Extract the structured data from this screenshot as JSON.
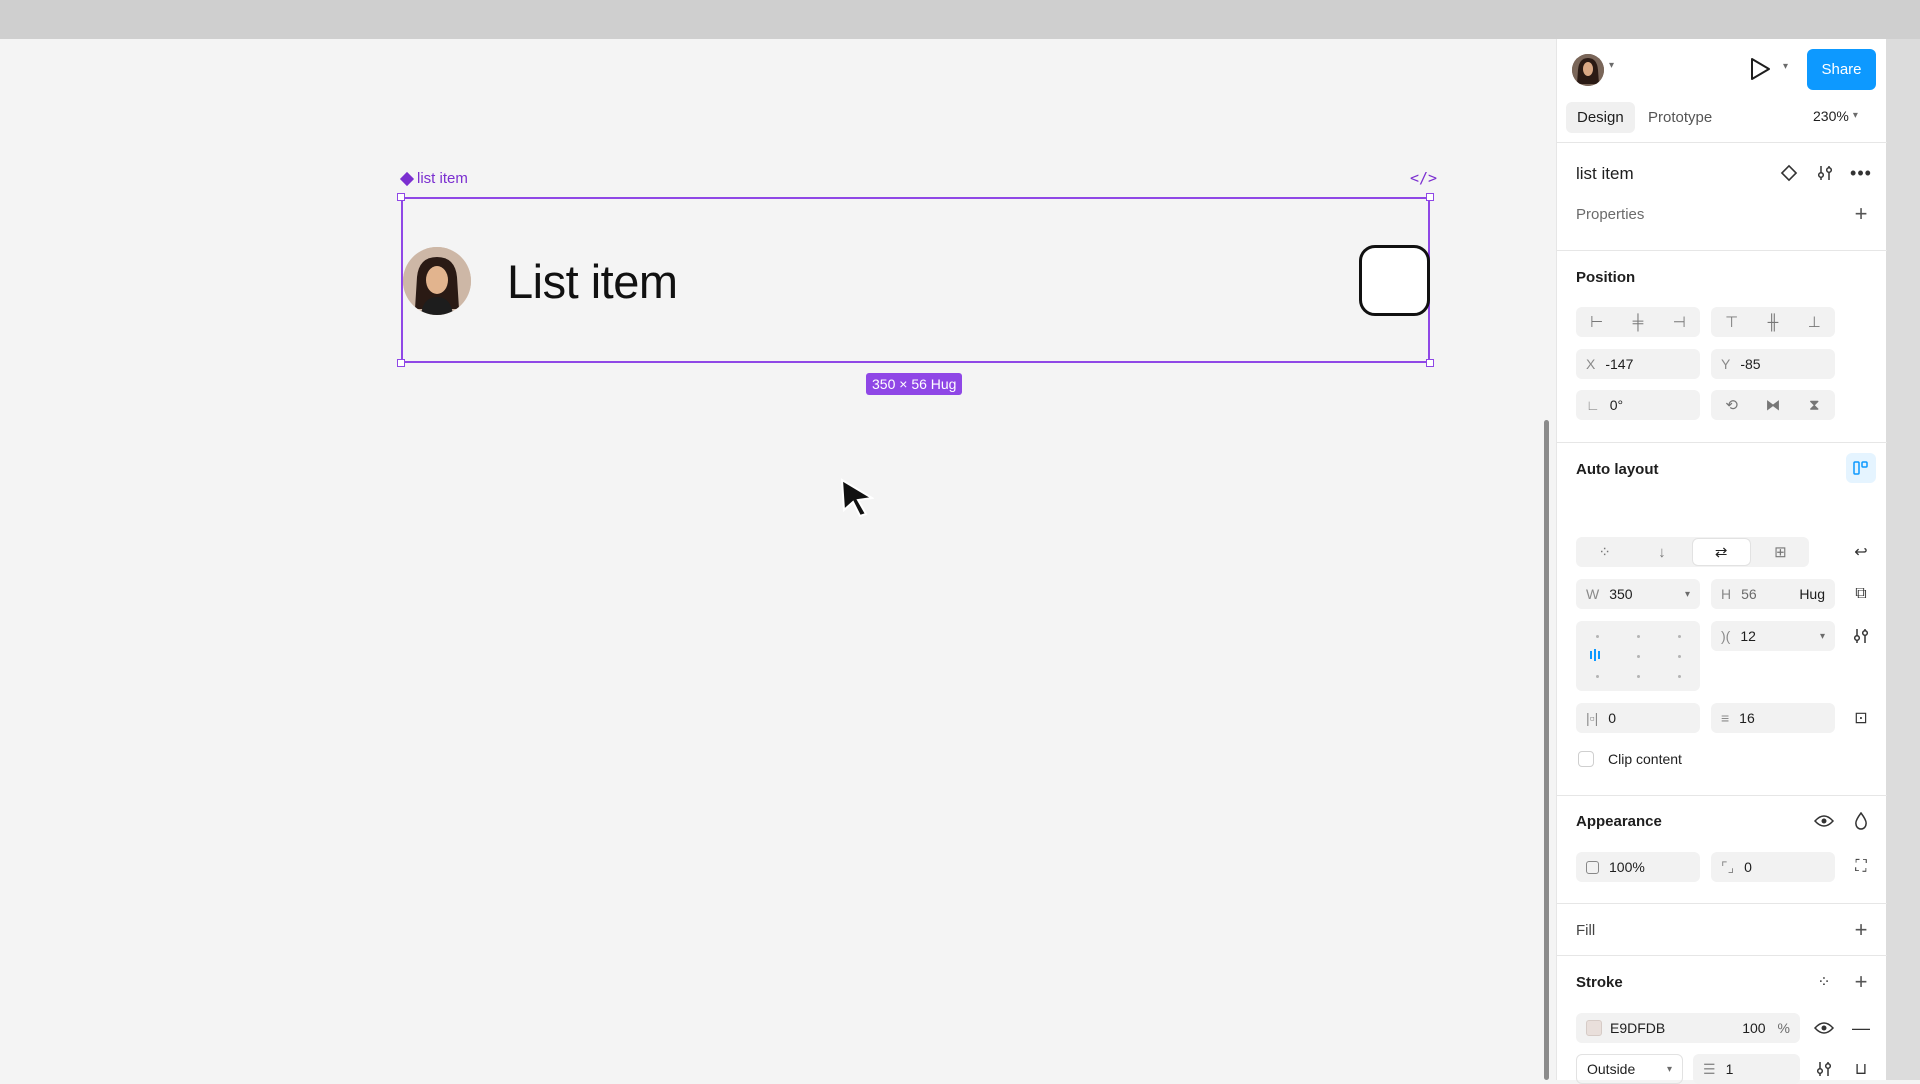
{
  "canvas": {
    "frame_label": "list item",
    "list_text": "List item",
    "size_badge": "350 × 56 Hug"
  },
  "header": {
    "share_label": "Share",
    "tabs": [
      {
        "label": "Design",
        "active": true
      },
      {
        "label": "Prototype",
        "active": false
      }
    ],
    "zoom": "230%"
  },
  "layer": {
    "name": "list item",
    "properties_label": "Properties"
  },
  "position": {
    "title": "Position",
    "x_label": "X",
    "x": "-147",
    "y_label": "Y",
    "y": "-85",
    "rotation": "0°"
  },
  "auto_layout": {
    "title": "Auto layout",
    "w_label": "W",
    "w": "350",
    "h_label": "H",
    "h": "56",
    "h_mode": "Hug",
    "gap": "12",
    "padding_h": "0",
    "padding_v": "16",
    "clip_label": "Clip content"
  },
  "appearance": {
    "title": "Appearance",
    "opacity": "100%",
    "radius": "0"
  },
  "fill": {
    "title": "Fill"
  },
  "stroke": {
    "title": "Stroke",
    "color_hex": "E9DFDB",
    "opacity": "100",
    "opacity_unit": "%",
    "position": "Outside",
    "weight": "1",
    "swatch": "#e9dfdb"
  },
  "colors": {
    "selection": "#8f47e6",
    "accent": "#0d99ff"
  }
}
